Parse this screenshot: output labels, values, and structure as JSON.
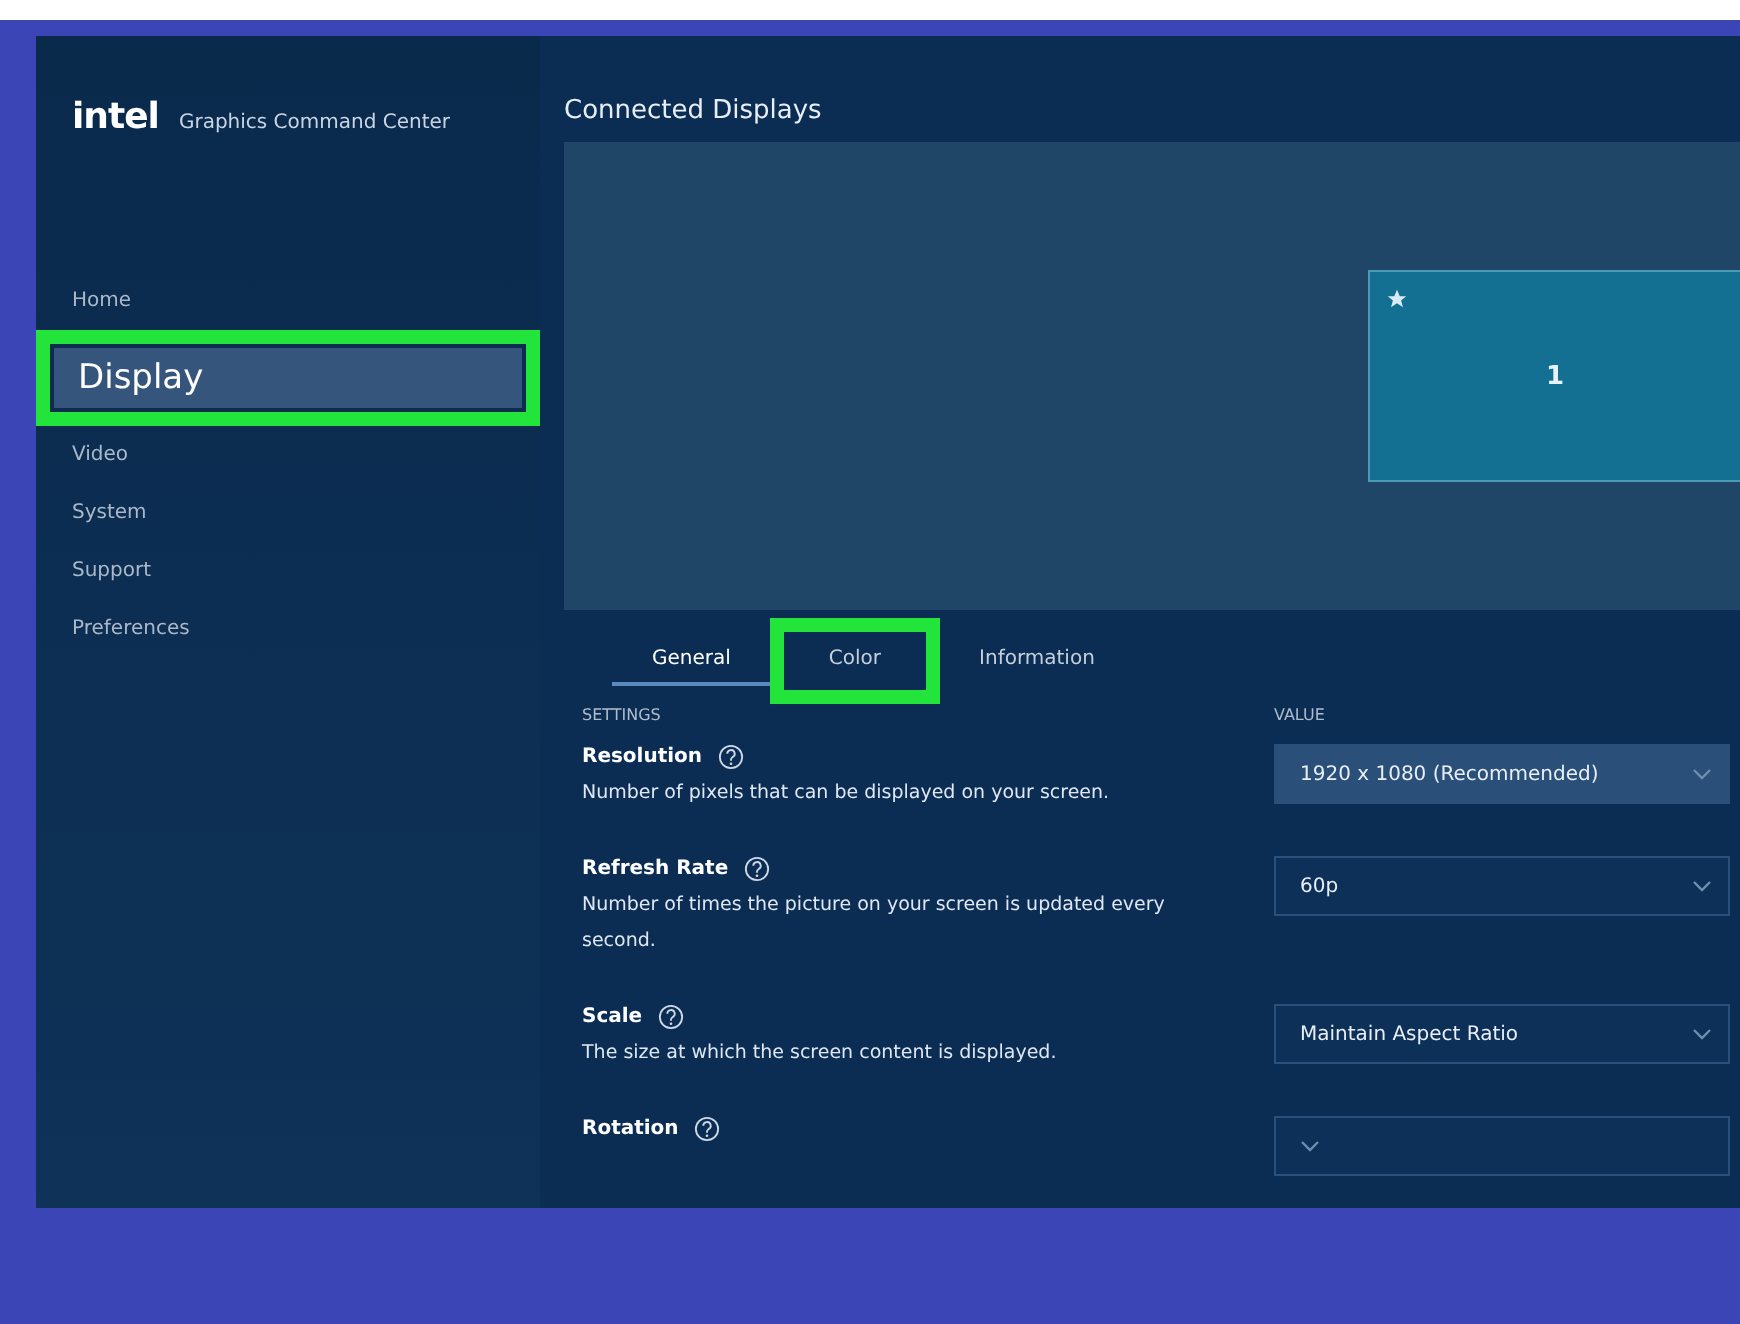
{
  "app": {
    "logo": "intel",
    "title": "Graphics Command Center"
  },
  "sidebar": {
    "items": [
      {
        "label": "Home",
        "selected": false,
        "highlighted": false
      },
      {
        "label": "Display",
        "selected": true,
        "highlighted": true
      },
      {
        "label": "Video",
        "selected": false,
        "highlighted": false
      },
      {
        "label": "System",
        "selected": false,
        "highlighted": false
      },
      {
        "label": "Support",
        "selected": false,
        "highlighted": false
      },
      {
        "label": "Preferences",
        "selected": false,
        "highlighted": false
      }
    ]
  },
  "connected_displays": {
    "title": "Connected Displays",
    "displays": [
      {
        "number": "1",
        "primary": true
      }
    ]
  },
  "tabs": [
    {
      "label": "General",
      "selected": true,
      "highlighted": false
    },
    {
      "label": "Color",
      "selected": false,
      "highlighted": true
    },
    {
      "label": "Information",
      "selected": false,
      "highlighted": false
    }
  ],
  "settings": {
    "columns": [
      "SETTINGS",
      "VALUE"
    ],
    "rows": [
      {
        "name": "Resolution",
        "description": "Number of pixels that can be displayed on your screen.",
        "value": "1920 x 1080 (Recommended)",
        "hovered": true
      },
      {
        "name": "Refresh Rate",
        "description": "Number of times the picture on your screen is updated every second.",
        "value": "60p",
        "hovered": false
      },
      {
        "name": "Scale",
        "description": "The size at which the screen content is displayed.",
        "value": "Maintain Aspect Ratio",
        "hovered": false
      },
      {
        "name": "Rotation",
        "hovered": false
      }
    ]
  }
}
